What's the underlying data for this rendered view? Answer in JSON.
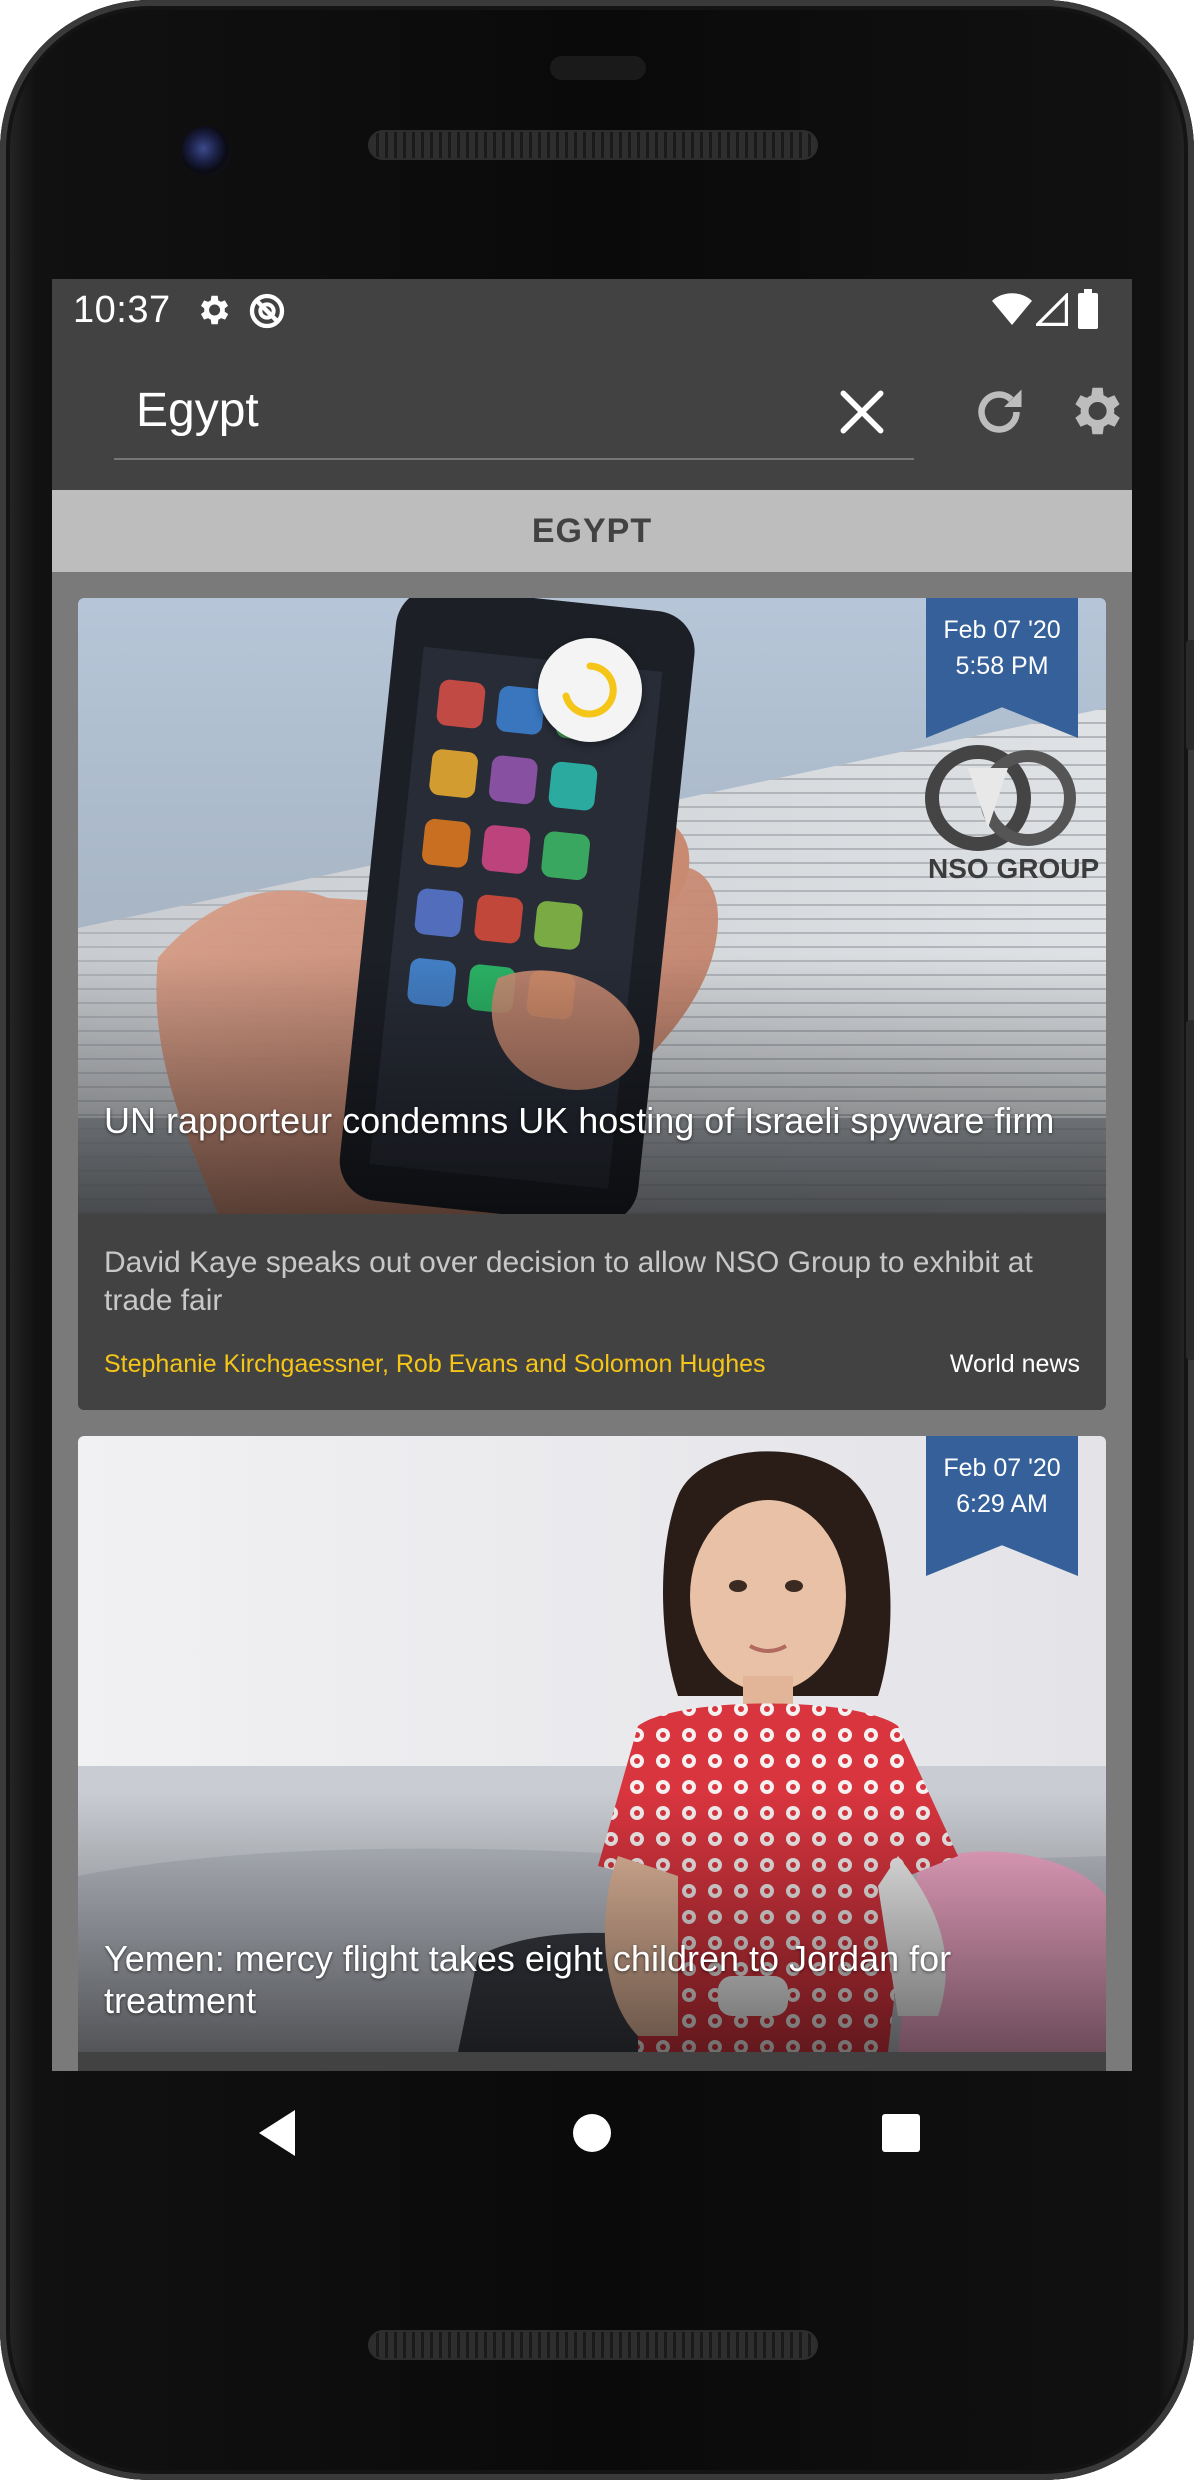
{
  "status_bar": {
    "time": "10:37",
    "icons": [
      "gear-icon",
      "do-not-disturb-icon",
      "wifi-icon",
      "cellular-signal-icon",
      "battery-icon"
    ]
  },
  "toolbar": {
    "search_value": "Egypt",
    "clear_icon": "close-icon",
    "refresh_icon": "refresh-icon",
    "settings_icon": "gear-icon"
  },
  "section": {
    "title": "EGYPT"
  },
  "articles": [
    {
      "date": "Feb 07 '20",
      "time": "5:58 PM",
      "headline": "UN rapporteur condemns UK hosting of Israeli spyware firm",
      "subtitle": "David Kaye speaks out over decision to allow NSO Group to exhibit at trade fair",
      "authors": "Stephanie Kirchgaessner, Rob Evans and Solomon Hughes",
      "category": "World news",
      "image_text": "NSO GROUP"
    },
    {
      "date": "Feb 07 '20",
      "time": "6:29 AM",
      "headline": "Yemen: mercy flight takes eight children to Jordan for treatment"
    }
  ],
  "colors": {
    "bar": "#424242",
    "section_header": "#bdbdbd",
    "feed_bg": "#7a7a7a",
    "ribbon": "#35609a",
    "author": "#f5c518",
    "spinner": "#f5c518"
  },
  "nav_bar": {
    "icons": [
      "back-icon",
      "home-icon",
      "recents-icon"
    ]
  }
}
